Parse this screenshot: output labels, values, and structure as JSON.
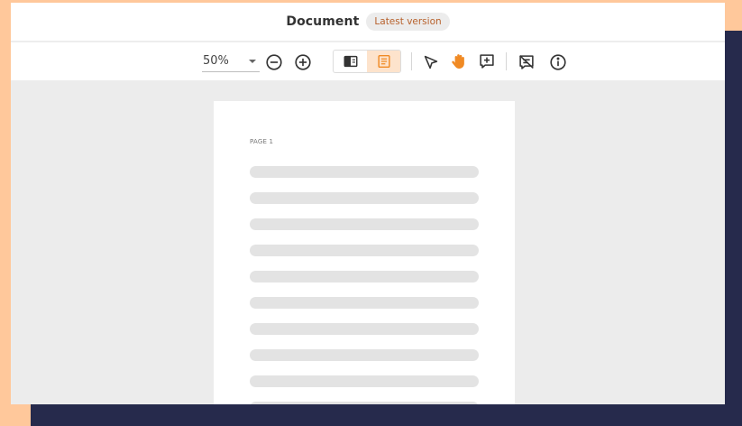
{
  "header": {
    "title": "Document",
    "version_badge": "Latest version"
  },
  "toolbar": {
    "zoom": {
      "value": "50%"
    },
    "icons": {
      "zoom_out": "minus-circle-icon",
      "zoom_in": "plus-circle-icon",
      "view_sidebar": "sidebar-layout-icon",
      "view_annotations": "notes-list-icon",
      "select": "cursor-arrow-icon",
      "pan": "hand-icon",
      "add_comment": "add-box-icon",
      "hide_comments": "comments-off-icon",
      "info": "info-icon"
    },
    "active_view": "view_annotations",
    "active_tool": "pan"
  },
  "document": {
    "pages": [
      {
        "label": "PAGE 1",
        "placeholder_lines": 10
      }
    ]
  },
  "colors": {
    "accent": "#f08a24",
    "accent_light": "#fde3cc",
    "badge_text": "#b8622d",
    "canvas_bg": "#ececec",
    "frame_peach": "#ffc89b",
    "frame_navy": "#262a4c",
    "placeholder_line": "#e3e3e3"
  }
}
